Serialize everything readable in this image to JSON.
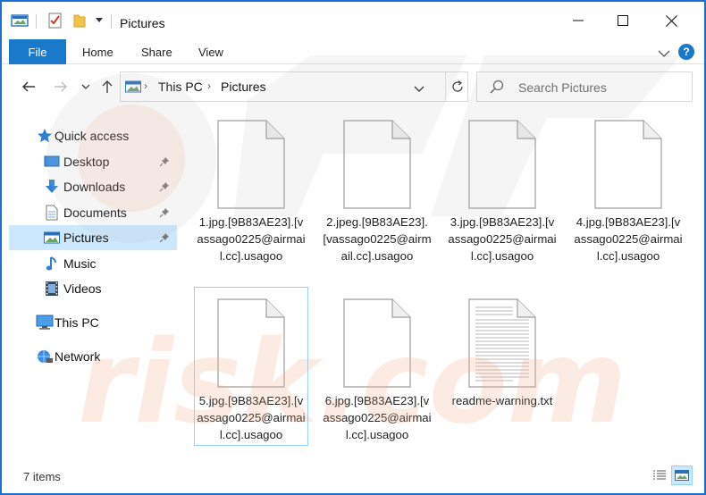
{
  "window": {
    "title": "Pictures",
    "quick_access_toolbar": [
      "app-icon",
      "properties-icon",
      "new-folder-icon",
      "chevron-down-icon"
    ],
    "controls": [
      "minimize-icon",
      "maximize-icon",
      "close-icon"
    ]
  },
  "ribbon": {
    "tabs": [
      "File",
      "Home",
      "Share",
      "View"
    ],
    "help_label": "?",
    "accent_color": "#1979ca"
  },
  "address": {
    "crumbs": [
      "This PC",
      "Pictures"
    ],
    "separator": "›"
  },
  "search": {
    "placeholder": "Search Pictures"
  },
  "nav": {
    "quick_access": "Quick access",
    "items": [
      {
        "label": "Desktop",
        "icon": "desktop-icon",
        "pinned": true
      },
      {
        "label": "Downloads",
        "icon": "downloads-icon",
        "pinned": true
      },
      {
        "label": "Documents",
        "icon": "documents-icon",
        "pinned": true
      },
      {
        "label": "Pictures",
        "icon": "pictures-icon",
        "pinned": true,
        "selected": true
      },
      {
        "label": "Music",
        "icon": "music-icon",
        "pinned": false
      },
      {
        "label": "Videos",
        "icon": "videos-icon",
        "pinned": false
      }
    ],
    "this_pc": "This PC",
    "network": "Network",
    "selected_color": "#cce8ff"
  },
  "files": [
    {
      "name": "1.jpg.[9B83AE23].[vassago0225@airmail.cc].usagoo",
      "type": "blank"
    },
    {
      "name": "2.jpeg.[9B83AE23].[vassago0225@airmail.cc].usagoo",
      "type": "blank"
    },
    {
      "name": "3.jpg.[9B83AE23].[vassago0225@airmail.cc].usagoo",
      "type": "blank"
    },
    {
      "name": "4.jpg.[9B83AE23].[vassago0225@airmail.cc].usagoo",
      "type": "blank"
    },
    {
      "name": "5.jpg.[9B83AE23].[vassago0225@airmail.cc].usagoo",
      "type": "blank",
      "focused": true
    },
    {
      "name": "6.jpg.[9B83AE23].[vassago0225@airmail.cc].usagoo",
      "type": "blank"
    },
    {
      "name": "readme-warning.txt",
      "type": "text"
    }
  ],
  "status": {
    "item_count": "7 items",
    "views": [
      "details-view-icon",
      "large-icons-view-icon"
    ]
  },
  "watermark": {
    "text": "risk.com"
  }
}
